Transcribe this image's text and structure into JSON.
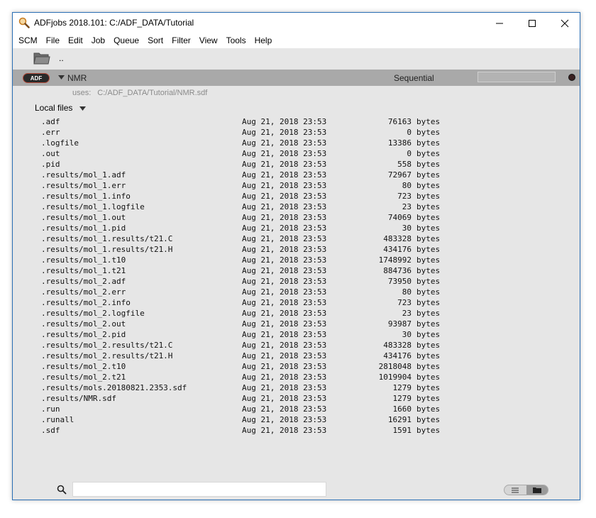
{
  "window": {
    "title": "ADFjobs 2018.101: C:/ADF_DATA/Tutorial"
  },
  "menu": [
    "SCM",
    "File",
    "Edit",
    "Job",
    "Queue",
    "Sort",
    "Filter",
    "View",
    "Tools",
    "Help"
  ],
  "toolbar": {
    "parent_dir": ".."
  },
  "job": {
    "badge": "ADF",
    "name": "NMR",
    "mode": "Sequential",
    "status_color": "#3a2020"
  },
  "uses": {
    "label": "uses:",
    "path": "C:/ADF_DATA/Tutorial/NMR.sdf"
  },
  "local_files": {
    "label": "Local files"
  },
  "files": [
    {
      "name": ".adf",
      "date": "Aug 21, 2018 23:53",
      "size": "76163",
      "unit": "bytes"
    },
    {
      "name": ".err",
      "date": "Aug 21, 2018 23:53",
      "size": "0",
      "unit": "bytes"
    },
    {
      "name": ".logfile",
      "date": "Aug 21, 2018 23:53",
      "size": "13386",
      "unit": "bytes"
    },
    {
      "name": ".out",
      "date": "Aug 21, 2018 23:53",
      "size": "0",
      "unit": "bytes"
    },
    {
      "name": ".pid",
      "date": "Aug 21, 2018 23:53",
      "size": "558",
      "unit": "bytes"
    },
    {
      "name": ".results/mol_1.adf",
      "date": "Aug 21, 2018 23:53",
      "size": "72967",
      "unit": "bytes"
    },
    {
      "name": ".results/mol_1.err",
      "date": "Aug 21, 2018 23:53",
      "size": "80",
      "unit": "bytes"
    },
    {
      "name": ".results/mol_1.info",
      "date": "Aug 21, 2018 23:53",
      "size": "723",
      "unit": "bytes"
    },
    {
      "name": ".results/mol_1.logfile",
      "date": "Aug 21, 2018 23:53",
      "size": "23",
      "unit": "bytes"
    },
    {
      "name": ".results/mol_1.out",
      "date": "Aug 21, 2018 23:53",
      "size": "74069",
      "unit": "bytes"
    },
    {
      "name": ".results/mol_1.pid",
      "date": "Aug 21, 2018 23:53",
      "size": "30",
      "unit": "bytes"
    },
    {
      "name": ".results/mol_1.results/t21.C",
      "date": "Aug 21, 2018 23:53",
      "size": "483328",
      "unit": "bytes"
    },
    {
      "name": ".results/mol_1.results/t21.H",
      "date": "Aug 21, 2018 23:53",
      "size": "434176",
      "unit": "bytes"
    },
    {
      "name": ".results/mol_1.t10",
      "date": "Aug 21, 2018 23:53",
      "size": "1748992",
      "unit": "bytes"
    },
    {
      "name": ".results/mol_1.t21",
      "date": "Aug 21, 2018 23:53",
      "size": "884736",
      "unit": "bytes"
    },
    {
      "name": ".results/mol_2.adf",
      "date": "Aug 21, 2018 23:53",
      "size": "73950",
      "unit": "bytes"
    },
    {
      "name": ".results/mol_2.err",
      "date": "Aug 21, 2018 23:53",
      "size": "80",
      "unit": "bytes"
    },
    {
      "name": ".results/mol_2.info",
      "date": "Aug 21, 2018 23:53",
      "size": "723",
      "unit": "bytes"
    },
    {
      "name": ".results/mol_2.logfile",
      "date": "Aug 21, 2018 23:53",
      "size": "23",
      "unit": "bytes"
    },
    {
      "name": ".results/mol_2.out",
      "date": "Aug 21, 2018 23:53",
      "size": "93987",
      "unit": "bytes"
    },
    {
      "name": ".results/mol_2.pid",
      "date": "Aug 21, 2018 23:53",
      "size": "30",
      "unit": "bytes"
    },
    {
      "name": ".results/mol_2.results/t21.C",
      "date": "Aug 21, 2018 23:53",
      "size": "483328",
      "unit": "bytes"
    },
    {
      "name": ".results/mol_2.results/t21.H",
      "date": "Aug 21, 2018 23:53",
      "size": "434176",
      "unit": "bytes"
    },
    {
      "name": ".results/mol_2.t10",
      "date": "Aug 21, 2018 23:53",
      "size": "2818048",
      "unit": "bytes"
    },
    {
      "name": ".results/mol_2.t21",
      "date": "Aug 21, 2018 23:53",
      "size": "1019904",
      "unit": "bytes"
    },
    {
      "name": ".results/mols.20180821.2353.sdf",
      "date": "Aug 21, 2018 23:53",
      "size": "1279",
      "unit": "bytes"
    },
    {
      "name": ".results/NMR.sdf",
      "date": "Aug 21, 2018 23:53",
      "size": "1279",
      "unit": "bytes"
    },
    {
      "name": ".run",
      "date": "Aug 21, 2018 23:53",
      "size": "1660",
      "unit": "bytes"
    },
    {
      "name": ".runall",
      "date": "Aug 21, 2018 23:53",
      "size": "16291",
      "unit": "bytes"
    },
    {
      "name": ".sdf",
      "date": "Aug 21, 2018 23:53",
      "size": "1591",
      "unit": "bytes"
    }
  ],
  "search": {
    "value": "",
    "placeholder": ""
  },
  "icons": {
    "app": "magnifier-app-icon",
    "parent_folder": "folder-icon",
    "search": "search-icon",
    "list_view": "list-view-icon",
    "folder_view": "folder-view-icon"
  }
}
